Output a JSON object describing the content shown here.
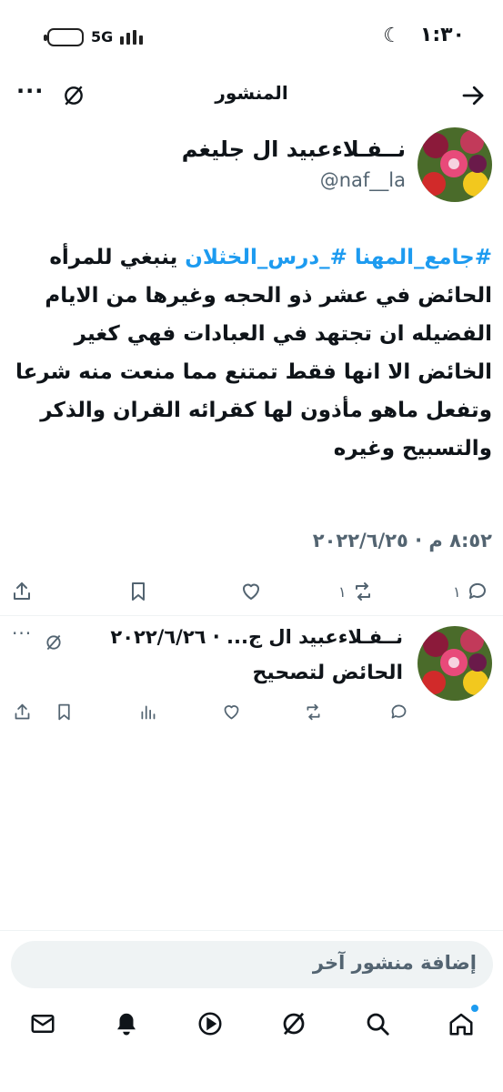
{
  "status_bar": {
    "time": "١:٣٠",
    "network": "5G"
  },
  "header": {
    "title": "المنشور"
  },
  "post": {
    "author_name": "نــفـلاءعبيد ال جليغم",
    "handle": "@naf__la",
    "hashtags": "#جامع_المهنا #_درس_الخثلان",
    "body_first": "ينبغي",
    "body_rest": "للمرأه الحائض  في عشر ذو الحجه وغيرها من الايام  الفضيله ان تجتهد في العبادات  فهي كغير  الخائض الا انها فقط تمتنع  مما منعت منه شرعا وتفعل ماهو مأذون لها كقرائه القران والذكر والتسبيح  وغيره",
    "timestamp": "٨:٥٢ م · ٢٠٢٢/٦/٢٥",
    "replies_count": "١",
    "reposts_count": "١"
  },
  "reply": {
    "header_text": "نــفـلاءعبيد ال ج... · ٢٠٢٢/٦/٢٦",
    "text": "الحائض لتصحيح"
  },
  "composer": {
    "placeholder": "إضافة منشور آخر"
  },
  "colors": {
    "accent": "#1d9bf0",
    "secondary_text": "#536471"
  }
}
